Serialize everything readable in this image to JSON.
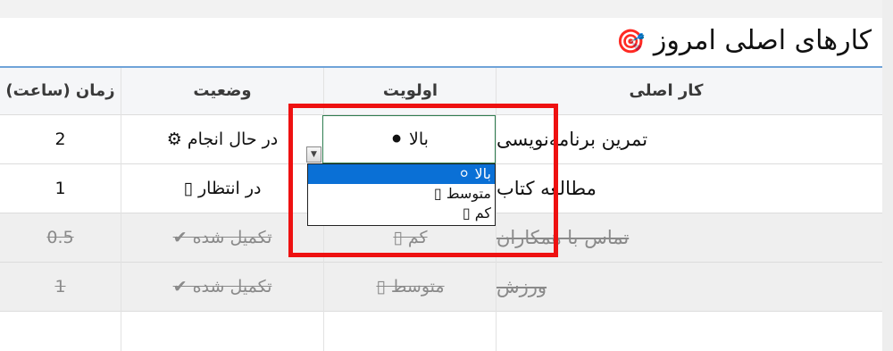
{
  "title": "کارهای اصلی امروز",
  "title_icon": "🎯",
  "columns": {
    "task": "کار اصلی",
    "priority": "اولویت",
    "status": "وضعیت",
    "time": "زمان (ساعت)"
  },
  "rows": [
    {
      "task": "تمرین برنامه‌نویسی",
      "priority": "",
      "status": "در حال انجام ⚙",
      "time": "2"
    },
    {
      "task": "مطالعه کتاب",
      "priority": "",
      "status": "در انتظار ▯",
      "time": "1"
    },
    {
      "task": "تماس با همکاران",
      "priority": "کم ▯",
      "status": "تکمیل شده ✔",
      "time": "0.5"
    },
    {
      "task": "ورزش",
      "priority": "متوسط ▯",
      "status": "تکمیل شده ✔",
      "time": "1"
    }
  ],
  "editor": {
    "value": "بالا ⚫"
  },
  "dropdown": {
    "options": [
      "بالا ⚪",
      "متوسط ▯",
      "کم ▯"
    ],
    "selected_index": 0
  },
  "colors": {
    "highlight": "#ee1111",
    "selection": "#0a70d6",
    "header_rule": "#6fa3d8"
  }
}
